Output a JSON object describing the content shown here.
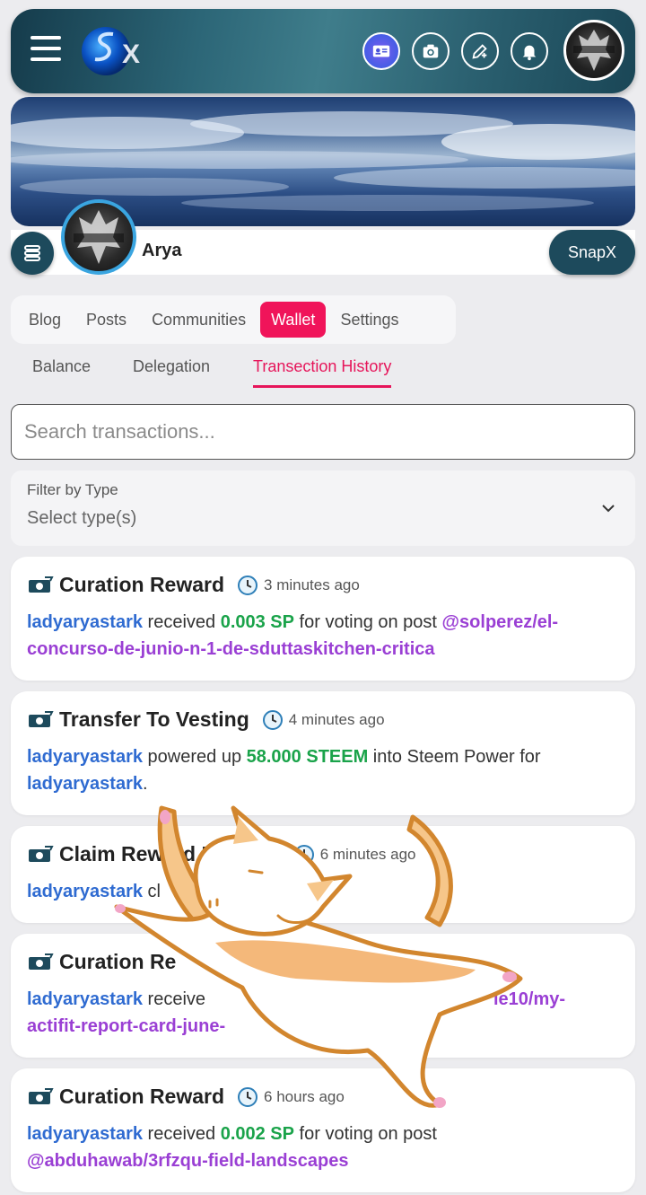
{
  "header": {
    "logo_letter": "X",
    "icons": [
      "contact-card-icon",
      "camera-icon",
      "edit-plus-icon",
      "bell-icon"
    ]
  },
  "profile": {
    "name": "Arya",
    "avatar_badge": "Arya Stark",
    "snapx_label": "SnapX"
  },
  "tabs": {
    "items": [
      {
        "label": "Blog"
      },
      {
        "label": "Posts"
      },
      {
        "label": "Communities"
      },
      {
        "label": "Wallet"
      },
      {
        "label": "Settings"
      }
    ],
    "active_index": 3
  },
  "subtabs": {
    "items": [
      {
        "label": "Balance"
      },
      {
        "label": "Delegation"
      },
      {
        "label": "Transection History"
      }
    ],
    "active_index": 2
  },
  "search": {
    "placeholder": "Search transactions..."
  },
  "filter": {
    "label": "Filter by Type",
    "value": "Select type(s)"
  },
  "transactions": [
    {
      "title": "Curation Reward",
      "time": "3 minutes ago",
      "user": "ladyaryastark",
      "text1": " received ",
      "amount": "0.003 SP",
      "text2": " for voting on post ",
      "link": "@solperez/el-concurso-de-junio-n-1-de-sduttaskitchen-critica",
      "text3": ""
    },
    {
      "title": "Transfer To Vesting",
      "time": "4 minutes ago",
      "user": "ladyaryastark",
      "text1": " powered up ",
      "amount": "58.000 STEEM",
      "text2": " into Steem Power for ",
      "link": "ladyaryastark",
      "text3": "."
    },
    {
      "title": "Claim Reward Balance",
      "time": "6 minutes ago",
      "user": "ladyaryastark",
      "text1": " cl",
      "amount": "",
      "text2": "",
      "link": "",
      "text3": ""
    },
    {
      "title": "Curation Re",
      "time": "",
      "user": "ladyaryastark",
      "text1": " receive",
      "amount": "",
      "text2": "",
      "link": "actifit-report-card-june-",
      "link_tail": "ie10/my-",
      "text3": ""
    },
    {
      "title": "Curation Reward",
      "time": "6 hours ago",
      "user": "ladyaryastark",
      "text1": " received ",
      "amount": "0.002 SP",
      "text2": " for voting on post ",
      "link": "@abduhawab/3rfzqu-field-landscapes",
      "text3": ""
    }
  ],
  "colors": {
    "accent": "#f0145a",
    "header": "#1d4a5c",
    "user_link": "#2f6bd1",
    "amount": "#1aa34a",
    "post_link": "#9a3fd4"
  }
}
